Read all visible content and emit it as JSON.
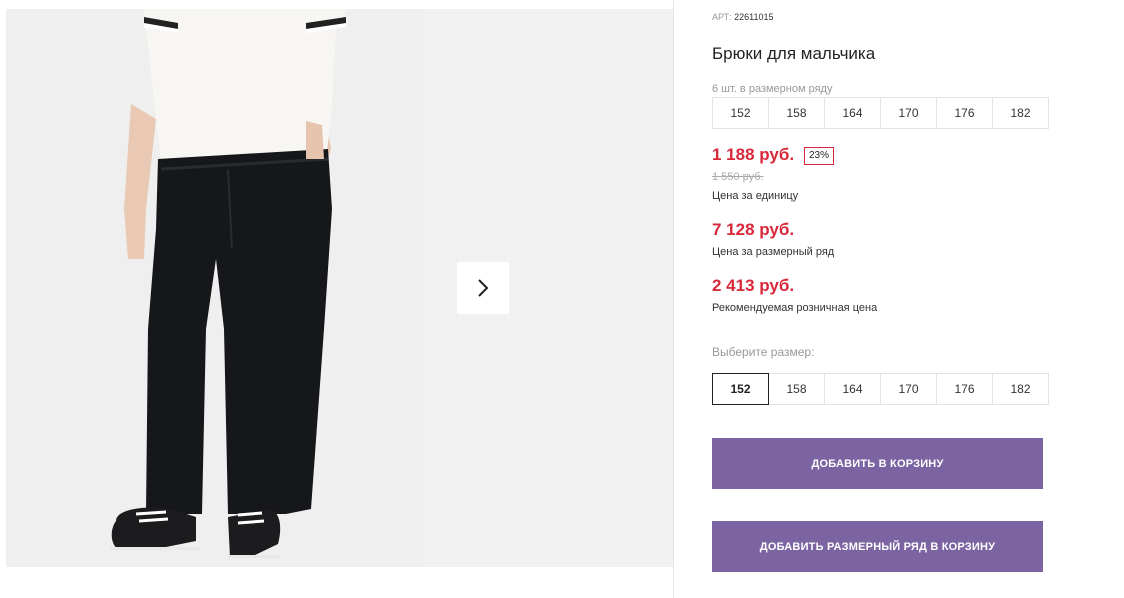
{
  "product": {
    "sku_label": "АРТ:",
    "sku": "22611015",
    "title": "Брюки для мальчика",
    "range_caption": "6 шт. в размерном ряду",
    "range_sizes": [
      "152",
      "158",
      "164",
      "170",
      "176",
      "182"
    ],
    "price": "1 188 руб.",
    "discount_badge": "23%",
    "old_price": "1 550 руб.",
    "price_caption": "Цена за единицу",
    "range_price": "7 128 руб.",
    "range_price_caption": "Цена за размерный ряд",
    "retail_price": "2 413 руб.",
    "retail_price_caption": "Рекомендуемая розничная цена",
    "choose_size_label": "Выберите размер:",
    "size_options": [
      "152",
      "158",
      "164",
      "170",
      "176",
      "182"
    ],
    "selected_size": "152",
    "add_to_cart": "ДОБАВИТЬ В КОРЗИНУ",
    "add_range_to_cart": "ДОБАВИТЬ РАЗМЕРНЫЙ РЯД В КОРЗИНУ"
  },
  "gallery": {
    "next_icon": "chevron-right-icon"
  },
  "colors": {
    "price_red": "#d9283a",
    "button_purple": "#7b64a1",
    "border_gray": "#e3e3e3"
  }
}
